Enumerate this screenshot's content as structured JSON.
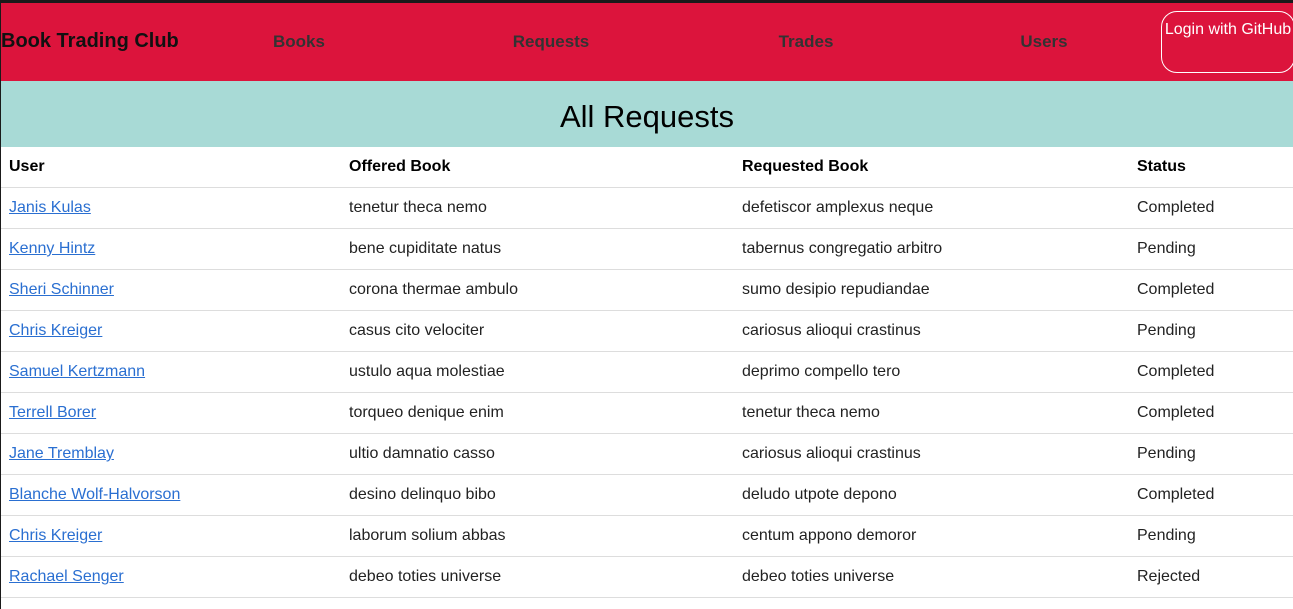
{
  "navbar": {
    "brand": "Book Trading Club",
    "links": [
      "Books",
      "Requests",
      "Trades",
      "Users"
    ],
    "login_label": "Login with GitHub"
  },
  "banner": {
    "title": "All Requests"
  },
  "table": {
    "headers": [
      "User",
      "Offered Book",
      "Requested Book",
      "Status"
    ],
    "rows": [
      {
        "user": "Janis Kulas",
        "offered": "tenetur theca nemo",
        "requested": "defetiscor amplexus neque",
        "status": "Completed"
      },
      {
        "user": "Kenny Hintz",
        "offered": "bene cupiditate natus",
        "requested": "tabernus congregatio arbitro",
        "status": "Pending"
      },
      {
        "user": "Sheri Schinner",
        "offered": "corona thermae ambulo",
        "requested": "sumo desipio repudiandae",
        "status": "Completed"
      },
      {
        "user": "Chris Kreiger",
        "offered": "casus cito velociter",
        "requested": "cariosus alioqui crastinus",
        "status": "Pending"
      },
      {
        "user": "Samuel Kertzmann",
        "offered": "ustulo aqua molestiae",
        "requested": "deprimo compello tero",
        "status": "Completed"
      },
      {
        "user": "Terrell Borer",
        "offered": "torqueo denique enim",
        "requested": "tenetur theca nemo",
        "status": "Completed"
      },
      {
        "user": "Jane Tremblay",
        "offered": "ultio damnatio casso",
        "requested": "cariosus alioqui crastinus",
        "status": "Pending"
      },
      {
        "user": "Blanche Wolf-Halvorson",
        "offered": "desino delinquo bibo",
        "requested": "deludo utpote depono",
        "status": "Completed"
      },
      {
        "user": "Chris Kreiger",
        "offered": "laborum solium abbas",
        "requested": "centum appono demoror",
        "status": "Pending"
      },
      {
        "user": "Rachael Senger",
        "offered": "debeo toties universe",
        "requested": "debeo toties universe",
        "status": "Rejected"
      }
    ]
  },
  "colors": {
    "navbar": "#dc143c",
    "banner": "#a8dad6",
    "link": "#2a6fd1"
  }
}
